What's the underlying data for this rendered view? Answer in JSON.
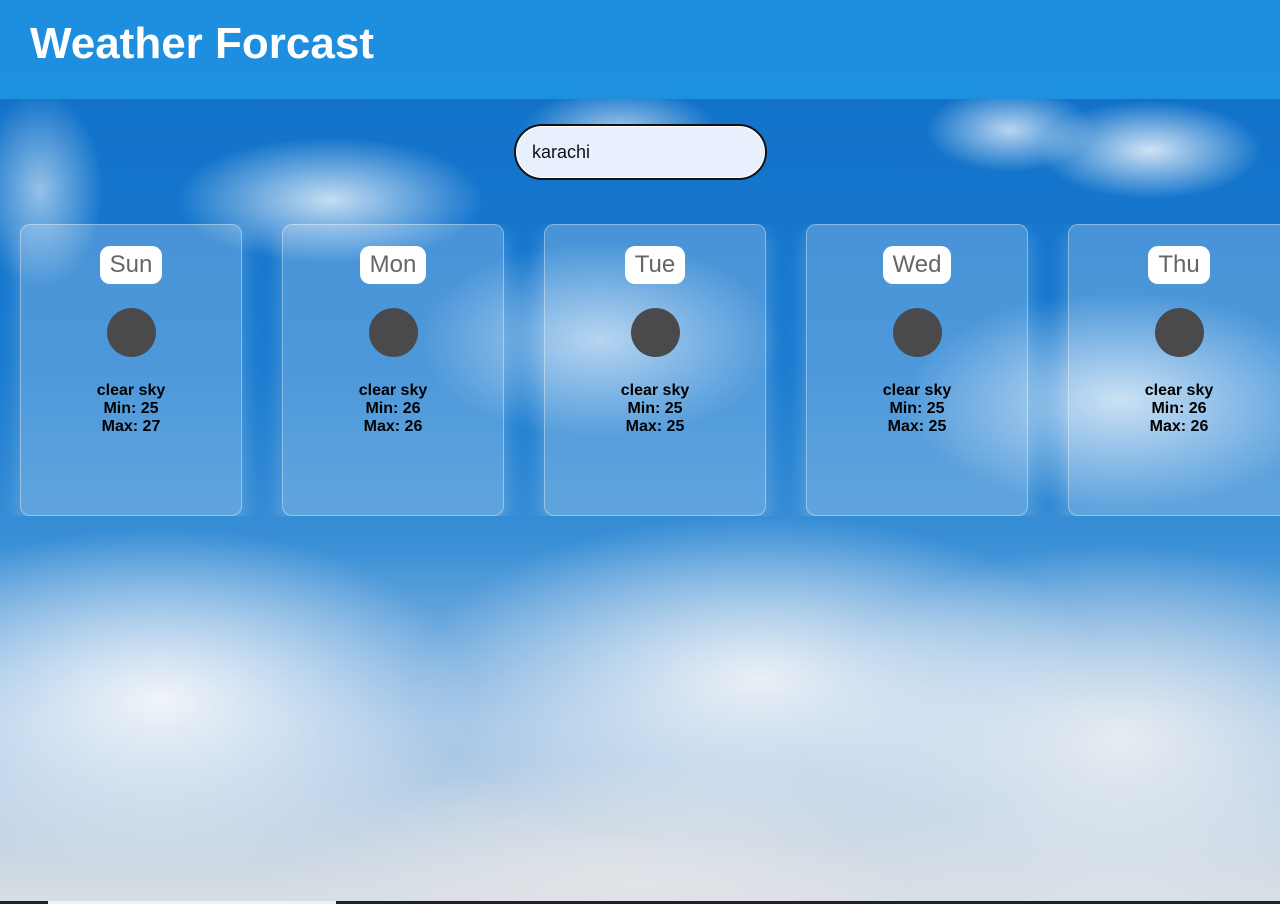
{
  "header": {
    "title": "Weather Forcast"
  },
  "search": {
    "value": "karachi"
  },
  "forecast": [
    {
      "day": "Sun",
      "condition": "clear sky",
      "min": "Min: 25",
      "max": "Max: 27",
      "icon": "weather-icon"
    },
    {
      "day": "Mon",
      "condition": "clear sky",
      "min": "Min: 26",
      "max": "Max: 26",
      "icon": "weather-icon"
    },
    {
      "day": "Tue",
      "condition": "clear sky",
      "min": "Min: 25",
      "max": "Max: 25",
      "icon": "weather-icon"
    },
    {
      "day": "Wed",
      "condition": "clear sky",
      "min": "Min: 25",
      "max": "Max: 25",
      "icon": "weather-icon"
    },
    {
      "day": "Thu",
      "condition": "clear sky",
      "min": "Min: 26",
      "max": "Max: 26",
      "icon": "weather-icon"
    }
  ],
  "colors": {
    "header": "#1e91de",
    "search_bg": "#e8f0fe",
    "icon_placeholder": "#4a4a4c"
  }
}
